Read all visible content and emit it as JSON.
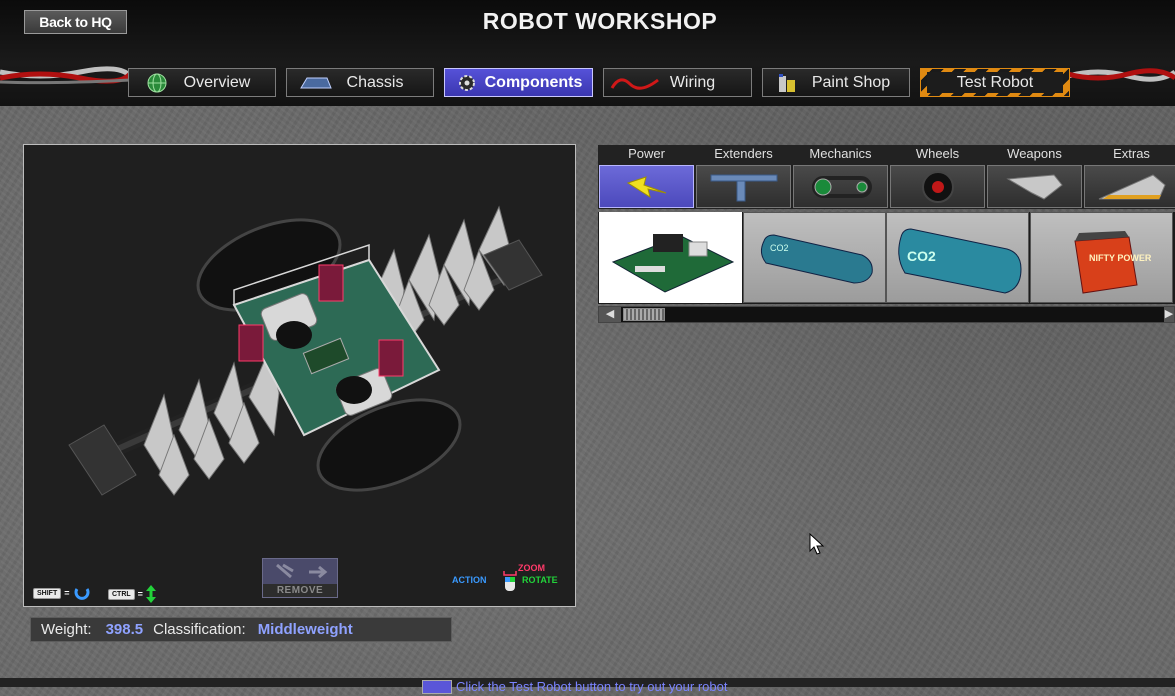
{
  "header": {
    "back_label": "Back to HQ",
    "title": "ROBOT WORKSHOP"
  },
  "tabs": [
    {
      "label": "Overview",
      "icon": "globe-icon"
    },
    {
      "label": "Chassis",
      "icon": "chassis-icon"
    },
    {
      "label": "Components",
      "icon": "gear-icon",
      "active": true
    },
    {
      "label": "Wiring",
      "icon": "wire-icon"
    },
    {
      "label": "Paint Shop",
      "icon": "paint-can-icon"
    },
    {
      "label": "Test Robot",
      "icon": "hazard-stripe"
    }
  ],
  "viewer": {
    "shift_key": "SHIFT",
    "ctrl_key": "CTRL",
    "equals": "=",
    "remove_label": "REMOVE",
    "zoom_label": "ZOOM",
    "action_label": "ACTION",
    "rotate_label": "ROTATE"
  },
  "stats": {
    "weight_label": "Weight:",
    "weight_value": "398.5",
    "class_label": "Classification:",
    "class_value": "Middleweight"
  },
  "categories": [
    {
      "label": "Power",
      "icon": "lightning-icon",
      "active": true
    },
    {
      "label": "Extenders",
      "icon": "extender-icon"
    },
    {
      "label": "Mechanics",
      "icon": "chain-drive-icon"
    },
    {
      "label": "Wheels",
      "icon": "wheel-icon"
    },
    {
      "label": "Weapons",
      "icon": "blade-icon"
    },
    {
      "label": "Extras",
      "icon": "wedge-icon"
    }
  ],
  "items": [
    {
      "name": "circuit-board",
      "label": "",
      "selected": true
    },
    {
      "name": "co2-tank-small",
      "label": "CO2"
    },
    {
      "name": "co2-tank-large",
      "label": "CO2"
    },
    {
      "name": "battery-box",
      "label": "NIFTY POWER"
    }
  ],
  "status": {
    "message": "Click the Test Robot button to try out your robot"
  },
  "colors": {
    "accent": "#4c49bc",
    "value_text": "#8fa2ff",
    "hazard": "#e08a12"
  }
}
